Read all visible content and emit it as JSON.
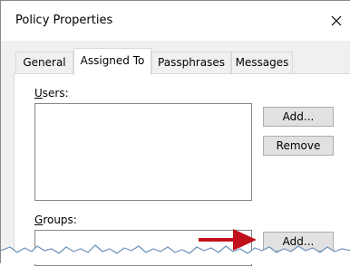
{
  "window": {
    "title": "Policy Properties"
  },
  "tabs": [
    {
      "label": "General",
      "active": false
    },
    {
      "label": "Assigned To",
      "active": true
    },
    {
      "label": "Passphrases",
      "active": false
    },
    {
      "label": "Messages",
      "active": false
    }
  ],
  "users": {
    "label_accel": "U",
    "label_rest": "sers:",
    "add_label": "Add...",
    "remove_label": "Remove"
  },
  "groups": {
    "label_accel": "G",
    "label_rest": "roups:",
    "add_label": "Add..."
  },
  "colors": {
    "arrow": "#c0101a",
    "dialog_bg": "#f0f0f0",
    "panel_bg": "#ffffff"
  },
  "icons": {
    "close": "close-icon",
    "arrow": "red-arrow-icon"
  }
}
